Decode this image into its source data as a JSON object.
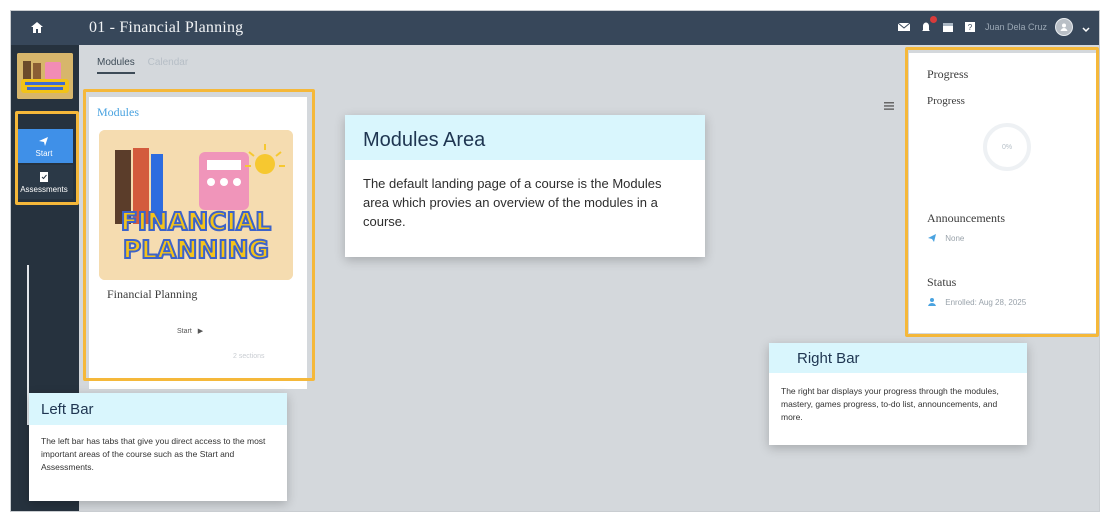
{
  "header": {
    "title": "01 - Financial Planning",
    "username": "Juan Dela Cruz",
    "icons": [
      "home-icon",
      "mail-icon",
      "notification-icon",
      "calendar-icon",
      "help-icon",
      "avatar-icon",
      "chevron-down-icon"
    ]
  },
  "sidebar": {
    "items": [
      {
        "label": "Start",
        "icon": "start-icon"
      },
      {
        "label": "Assessments",
        "icon": "assessment-icon"
      }
    ]
  },
  "main": {
    "tabs": [
      {
        "label": "Modules"
      },
      {
        "label": "Calendar"
      }
    ],
    "modules": {
      "heading": "Modules",
      "module_title": "Financial Planning",
      "image_text_1": "FINANCIAL",
      "image_text_2": "PLANNING",
      "start_label": "Start",
      "sections": "2 sections"
    }
  },
  "rightbar": {
    "title": "Progress",
    "subtitle": "Progress",
    "progress_value": "0%",
    "announcements_label": "Announcements",
    "announcements_value": "None",
    "status_label": "Status",
    "status_value": "Enrolled: Aug 28, 2025"
  },
  "callouts": {
    "modules": {
      "title": "Modules Area",
      "body": "The default landing page of a course is the Modules area which provies an overview of the modules in a course."
    },
    "right": {
      "title": "Right Bar",
      "body": "The right bar displays your progress through the modules, mastery, games progress, to-do list, announcements, and more."
    },
    "left": {
      "title": "Left Bar",
      "body": "The left bar has tabs that give you direct access to the most important areas of the course such as the Start and Assessments."
    }
  },
  "colors": {
    "topbar": "#37475a",
    "sidebar": "#26323e",
    "active_nav": "#3f90e8",
    "highlight_border": "#f5b83a",
    "callout_header": "#d9f6fd",
    "accent_text": "#4aa3e0"
  }
}
